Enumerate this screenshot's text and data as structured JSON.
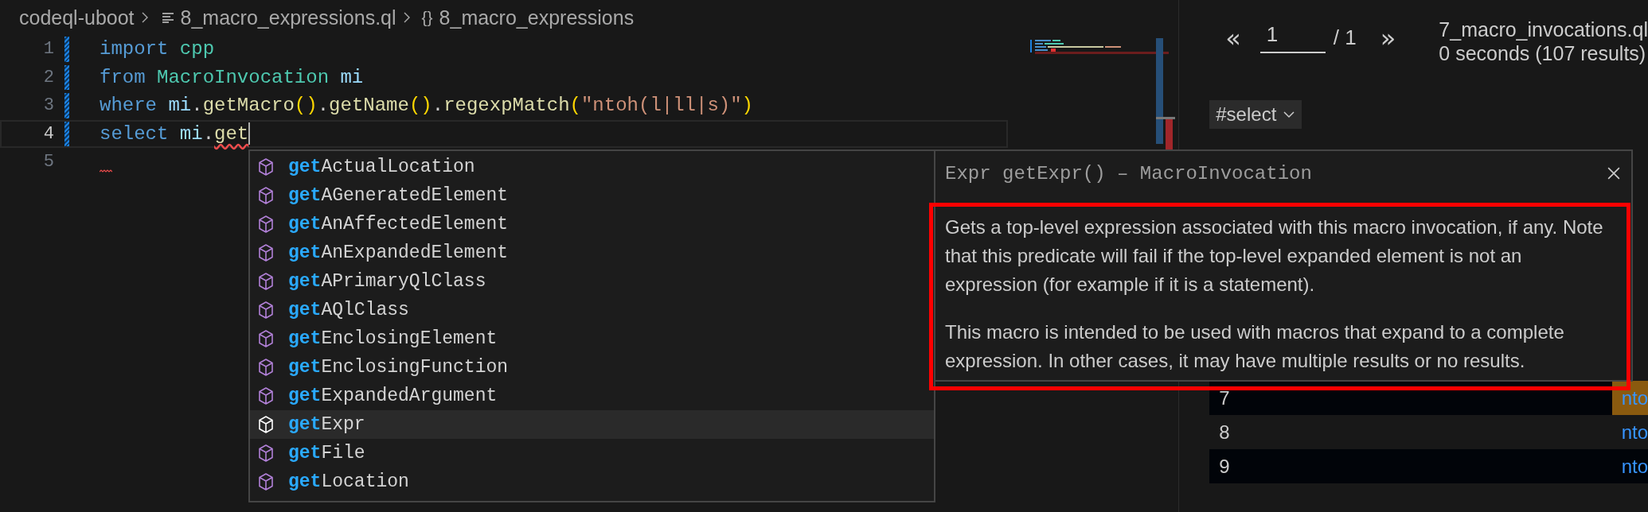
{
  "breadcrumb": [
    {
      "kind": "folder",
      "label": "codeql-uboot"
    },
    {
      "kind": "file",
      "label": "8_macro_expressions.ql"
    },
    {
      "kind": "symbol",
      "icon_text": "{}",
      "label": "8_macro_expressions"
    }
  ],
  "code_lines": [
    {
      "number": "1",
      "changed": true,
      "current": false,
      "error": false,
      "tokens": [
        {
          "kind": "keyword",
          "text": "import "
        },
        {
          "kind": "type",
          "text": "cpp"
        }
      ]
    },
    {
      "number": "2",
      "changed": true,
      "current": false,
      "error": false,
      "tokens": [
        {
          "kind": "keyword",
          "text": "from "
        },
        {
          "kind": "type",
          "text": "MacroInvocation "
        },
        {
          "kind": "var",
          "text": "mi"
        }
      ]
    },
    {
      "number": "3",
      "changed": true,
      "current": false,
      "error": false,
      "tokens": [
        {
          "kind": "keyword",
          "text": "where "
        },
        {
          "kind": "var",
          "text": "mi"
        },
        {
          "kind": "punct",
          "text": "."
        },
        {
          "kind": "func",
          "text": "getMacro"
        },
        {
          "kind": "bracket",
          "text": "()"
        },
        {
          "kind": "punct",
          "text": "."
        },
        {
          "kind": "func",
          "text": "getName"
        },
        {
          "kind": "bracket",
          "text": "()"
        },
        {
          "kind": "punct",
          "text": "."
        },
        {
          "kind": "func",
          "text": "regexpMatch"
        },
        {
          "kind": "bracket",
          "text": "("
        },
        {
          "kind": "string",
          "text": "\"ntoh(l|ll|s)\""
        },
        {
          "kind": "bracket",
          "text": ")"
        }
      ]
    },
    {
      "number": "4",
      "changed": true,
      "current": true,
      "error": false,
      "tokens": [
        {
          "kind": "keyword",
          "text": "select "
        },
        {
          "kind": "var",
          "text": "mi"
        },
        {
          "kind": "punct",
          "text": "."
        },
        {
          "kind": "error",
          "text": "get"
        }
      ]
    },
    {
      "number": "5",
      "changed": false,
      "current": false,
      "error": true
    }
  ],
  "suggestions": [
    {
      "match": "get",
      "rest": "ActualLocation",
      "selected": false
    },
    {
      "match": "get",
      "rest": "AGeneratedElement",
      "selected": false
    },
    {
      "match": "get",
      "rest": "AnAffectedElement",
      "selected": false
    },
    {
      "match": "get",
      "rest": "AnExpandedElement",
      "selected": false
    },
    {
      "match": "get",
      "rest": "APrimaryQlClass",
      "selected": false
    },
    {
      "match": "get",
      "rest": "AQlClass",
      "selected": false
    },
    {
      "match": "get",
      "rest": "EnclosingElement",
      "selected": false
    },
    {
      "match": "get",
      "rest": "EnclosingFunction",
      "selected": false
    },
    {
      "match": "get",
      "rest": "ExpandedArgument",
      "selected": false
    },
    {
      "match": "get",
      "rest": "Expr",
      "selected": true
    },
    {
      "match": "get",
      "rest": "File",
      "selected": false
    },
    {
      "match": "get",
      "rest": "Location",
      "selected": false
    }
  ],
  "details": {
    "signature": "Expr getExpr() – MacroInvocation",
    "paragraphs": [
      "Gets a top-level expression associated with this macro invocation, if any. Note that this predicate will fail if the top-level expanded element is not an expression (for example if it is a statement).",
      "This macro is intended to be used with macros that expand to a complete expression. In other cases, it may have multiple results or no results."
    ]
  },
  "results": {
    "pager": {
      "prev": "«",
      "page": "1",
      "total": "/ 1",
      "next": "»"
    },
    "query_name": "7_macro_invocations.ql",
    "summary": "0 seconds (107 results)",
    "result_set": "#select",
    "rows": [
      {
        "index": "7",
        "value": "nto",
        "selected": true
      },
      {
        "index": "8",
        "value": "nto",
        "selected": false
      },
      {
        "index": "9",
        "value": "nto",
        "selected": false
      }
    ]
  }
}
